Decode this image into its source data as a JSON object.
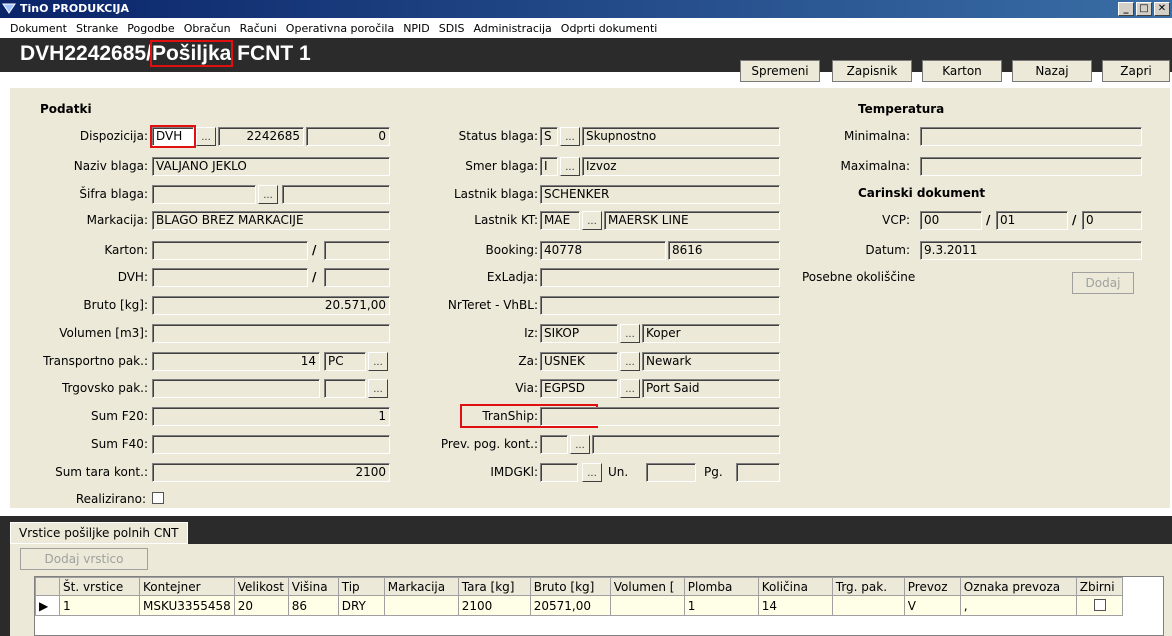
{
  "window": {
    "title": "TinO  PRODUKCIJA",
    "min": "_",
    "max": "□",
    "close": "✕"
  },
  "menu": [
    "Dokument",
    "Stranke",
    "Pogodbe",
    "Obračun",
    "Računi",
    "Operativna poročila",
    "NPID",
    "SDIS",
    "Administracija",
    "Odprti dokumenti"
  ],
  "header": {
    "title_prefix": "DVH2242685/",
    "title_highlight": "Pošiljka",
    "title_suffix": " FCNT 1",
    "buttons": [
      "Spremeni",
      "Zapisnik",
      "Karton",
      "Nazaj",
      "Zapri"
    ]
  },
  "podatki": {
    "heading": "Podatki",
    "dispozicija": {
      "label": "Dispozicija:",
      "code": "DVH",
      "number": "2242685",
      "zero": "0"
    },
    "naziv_blaga": {
      "label": "Naziv blaga:",
      "value": "VALJANO JEKLO"
    },
    "sifra_blaga": {
      "label": "Šifra blaga:",
      "value": ""
    },
    "markacija": {
      "label": "Markacija:",
      "value": "BLAGO BREZ MARKACIJE"
    },
    "karton": {
      "label": "Karton:"
    },
    "dvh": {
      "label": "DVH:"
    },
    "bruto": {
      "label": "Bruto [kg]:",
      "value": "20.571,00"
    },
    "volumen": {
      "label": "Volumen [m3]:",
      "value": ""
    },
    "transportno_pak": {
      "label": "Transportno pak.:",
      "value": "14",
      "unit": "PC"
    },
    "trgovsko_pak": {
      "label": "Trgovsko pak.:",
      "value": ""
    },
    "sum_f20": {
      "label": "Sum F20:",
      "value": "1"
    },
    "sum_f40": {
      "label": "Sum F40:",
      "value": ""
    },
    "sum_tara": {
      "label": "Sum tara kont.:",
      "value": "2100"
    },
    "realizirano": {
      "label": "Realizirano:"
    }
  },
  "middle": {
    "status_blaga": {
      "label": "Status blaga:",
      "code": "S",
      "value": "Skupnostno"
    },
    "smer_blaga": {
      "label": "Smer blaga:",
      "code": "I",
      "value": "Izvoz"
    },
    "lastnik_blaga": {
      "label": "Lastnik blaga:",
      "value": "SCHENKER"
    },
    "lastnik_kt": {
      "label": "Lastnik KT:",
      "code": "MAE",
      "value": "MAERSK LINE"
    },
    "booking": {
      "label": "Booking:",
      "value1": "40778",
      "value2": "8616"
    },
    "exladja": {
      "label": "ExLadja:"
    },
    "nrteret": {
      "label": "NrTeret - VhBL:"
    },
    "iz": {
      "label": "Iz:",
      "code": "SIKOP",
      "value": "Koper"
    },
    "za": {
      "label": "Za:",
      "code": "USNEK",
      "value": "Newark"
    },
    "via": {
      "label": "Via:",
      "code": "EGPSD",
      "value": "Port Said"
    },
    "tranship": {
      "label": "TranShip:"
    },
    "prev_pog": {
      "label": "Prev. pog. kont.:"
    },
    "imdgkl": {
      "label": "IMDGKl:",
      "un": "Un.",
      "pg": "Pg."
    }
  },
  "right": {
    "temperatura": "Temperatura",
    "minimalna": "Minimalna:",
    "maximalna": "Maximalna:",
    "carinski": "Carinski dokument",
    "vcp": {
      "label": "VCP:",
      "v1": "00",
      "v2": "01",
      "v3": "0"
    },
    "datum": {
      "label": "Datum:",
      "value": "9.3.2011"
    },
    "posebne": "Posebne okoliščine",
    "dodaj": "Dodaj"
  },
  "lower": {
    "tab": "Vrstice pošiljke polnih CNT",
    "add_row": "Dodaj vrstico",
    "columns": [
      "Št. vrstice",
      "Kontejner",
      "Velikost",
      "Višina",
      "Tip",
      "Markacija",
      "Tara [kg]",
      "Bruto [kg]",
      "Volumen [",
      "Plomba",
      "Količina",
      "Trg. pak.",
      "Prevoz",
      "Oznaka prevoza",
      "Zbirni"
    ],
    "rows": [
      [
        "1",
        "MSKU3355458",
        "20",
        "86",
        "DRY",
        "",
        "2100",
        "20571,00",
        "",
        "1",
        "14",
        "",
        "V",
        ",",
        ""
      ]
    ]
  }
}
